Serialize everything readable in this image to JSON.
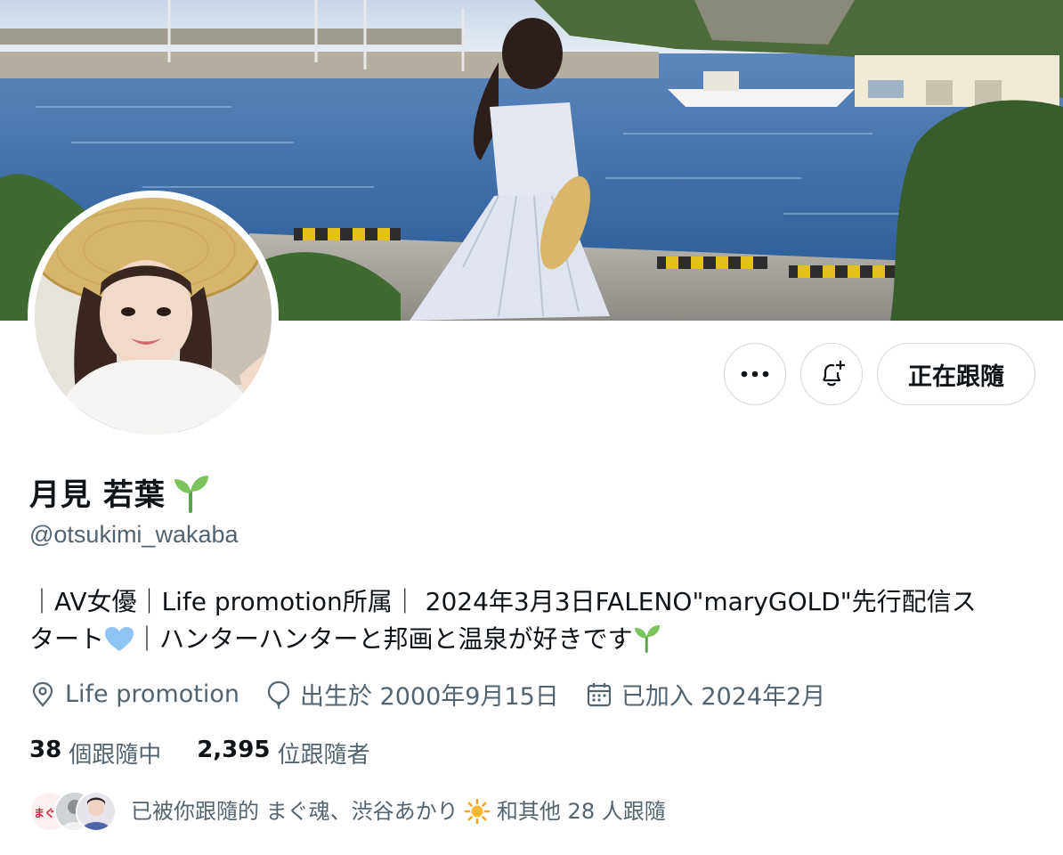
{
  "profile": {
    "display_name": "月見 若葉",
    "handle": "@otsukimi_wakaba",
    "bio_line1": "｜AV女優｜Life promotion所属｜ 2024年3月3日FALENO\"maryGOLD\"先行配信ス",
    "bio_line2_a": "タート",
    "bio_line2_b": "｜ハンターハンターと邦画と温泉が好きです"
  },
  "meta": {
    "location": "Life promotion",
    "birthday": "出生於 2000年9月15日",
    "joined": "已加入 2024年2月"
  },
  "stats": {
    "following_count": "38",
    "following_label": "個跟隨中",
    "followers_count": "2,395",
    "followers_label": "位跟隨者"
  },
  "actions": {
    "follow_label": "正在跟隨"
  },
  "known_followers": {
    "text": "已被你跟隨的 まぐ魂、渋谷あかり",
    "text_suffix": "和其他 28 人跟隨",
    "avatar1_text": "まぐ魂"
  },
  "icons": {
    "more": "more-icon",
    "notify": "bell-plus-icon",
    "location": "location-pin-icon",
    "birthday": "balloon-icon",
    "joined": "calendar-icon",
    "seedling": "seedling-emoji",
    "heart": "blue-heart-emoji",
    "sun": "sun-emoji"
  },
  "colors": {
    "text_primary": "#0f1419",
    "text_secondary": "#536471",
    "border": "#cfd9de",
    "water": "#3f6fa8"
  }
}
